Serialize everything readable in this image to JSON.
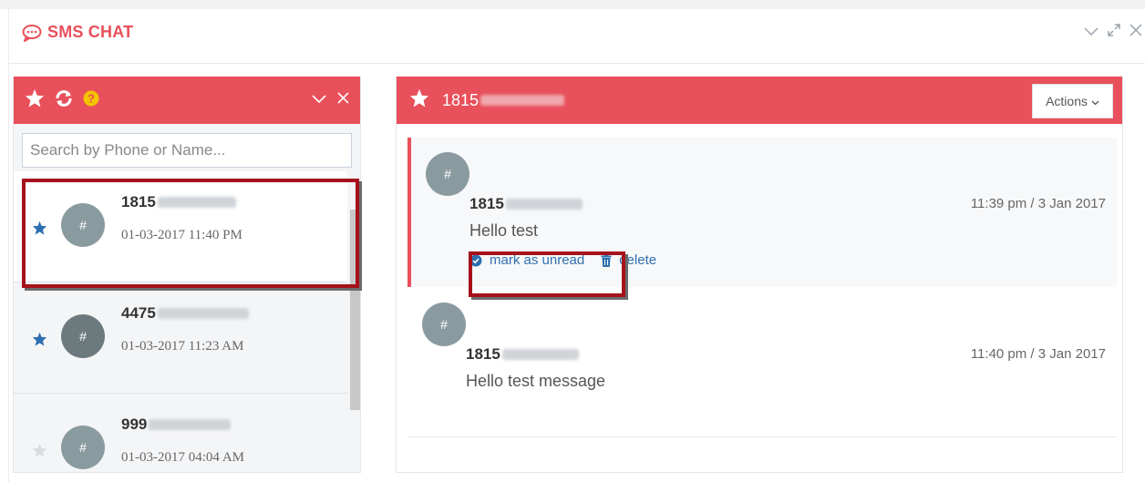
{
  "app": {
    "title": "SMS CHAT",
    "accent_color": "#e8505b"
  },
  "window_controls": [
    "chevron-down-icon",
    "expand-icon",
    "close-icon"
  ],
  "left_panel": {
    "header_icons": [
      "star-icon",
      "refresh-icon",
      "help-icon"
    ],
    "header_right_icons": [
      "chevron-down-icon",
      "close-icon"
    ],
    "search": {
      "placeholder": "Search by Phone or Name...",
      "value": ""
    },
    "contacts": [
      {
        "phone_prefix": "1815",
        "date": "01-03-2017 11:40 PM",
        "starred": true,
        "active": true
      },
      {
        "phone_prefix": "4475",
        "date": "01-03-2017 11:23 AM",
        "starred": true,
        "active": false
      },
      {
        "phone_prefix": "999",
        "date": "01-03-2017 04:04 AM",
        "starred": false,
        "active": false
      }
    ]
  },
  "right_panel": {
    "header_phone_prefix": "1815",
    "actions_label": "Actions",
    "messages": [
      {
        "avatar": "#",
        "sender_prefix": "1815",
        "time": "11:39 pm / 3 Jan 2017",
        "text": "Hello test",
        "mark_unread_label": "mark as unread",
        "delete_label": "delete"
      },
      {
        "avatar": "#",
        "sender_prefix": "1815",
        "time": "11:40 pm / 3 Jan 2017",
        "text": "Hello test message"
      }
    ]
  },
  "avatar_text": "#"
}
